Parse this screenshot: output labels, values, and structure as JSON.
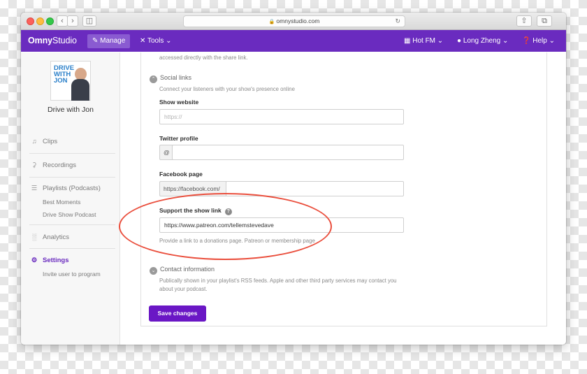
{
  "browser": {
    "url": "omnystudio.com"
  },
  "navbar": {
    "brand_prefix": "Omny",
    "brand_suffix": "Studio",
    "manage_label": "Manage",
    "tools_label": "Tools",
    "station_label": "Hot FM",
    "user_label": "Long Zheng",
    "help_label": "Help",
    "accent_color": "#6a2bbf"
  },
  "sidebar": {
    "cover_text": "DRIVE WITH JON",
    "show_name": "Drive with Jon",
    "items": [
      {
        "label": "Clips",
        "icon": "music-note-icon"
      },
      {
        "label": "Recordings",
        "icon": "microphone-icon"
      },
      {
        "label": "Playlists (Podcasts)",
        "icon": "list-icon"
      },
      {
        "label": "Analytics",
        "icon": "bar-chart-icon"
      },
      {
        "label": "Settings",
        "icon": "gear-icon"
      }
    ],
    "playlists": [
      "Best Moments",
      "Drive Show Podcast"
    ],
    "settings_sub": "Invite user to program"
  },
  "main": {
    "top_text": "accessed directly with the share link.",
    "social": {
      "title": "Social links",
      "desc": "Connect your listeners with your show's presence online",
      "website_label": "Show website",
      "website_placeholder": "https://",
      "twitter_label": "Twitter profile",
      "twitter_prefix": "@",
      "facebook_label": "Facebook page",
      "facebook_prefix": "https://facebook.com/",
      "support_label": "Support the show link",
      "support_value": "https://www.patreon.com/tellemstevedave",
      "support_help": "Provide a link to a donations page. Patreon or membership page"
    },
    "contact": {
      "title": "Contact information",
      "desc1": "Publically shown in your playlist's RSS feeds. Apple and other third party services may contact you",
      "desc2": "about your podcast."
    },
    "save_label": "Save changes"
  }
}
